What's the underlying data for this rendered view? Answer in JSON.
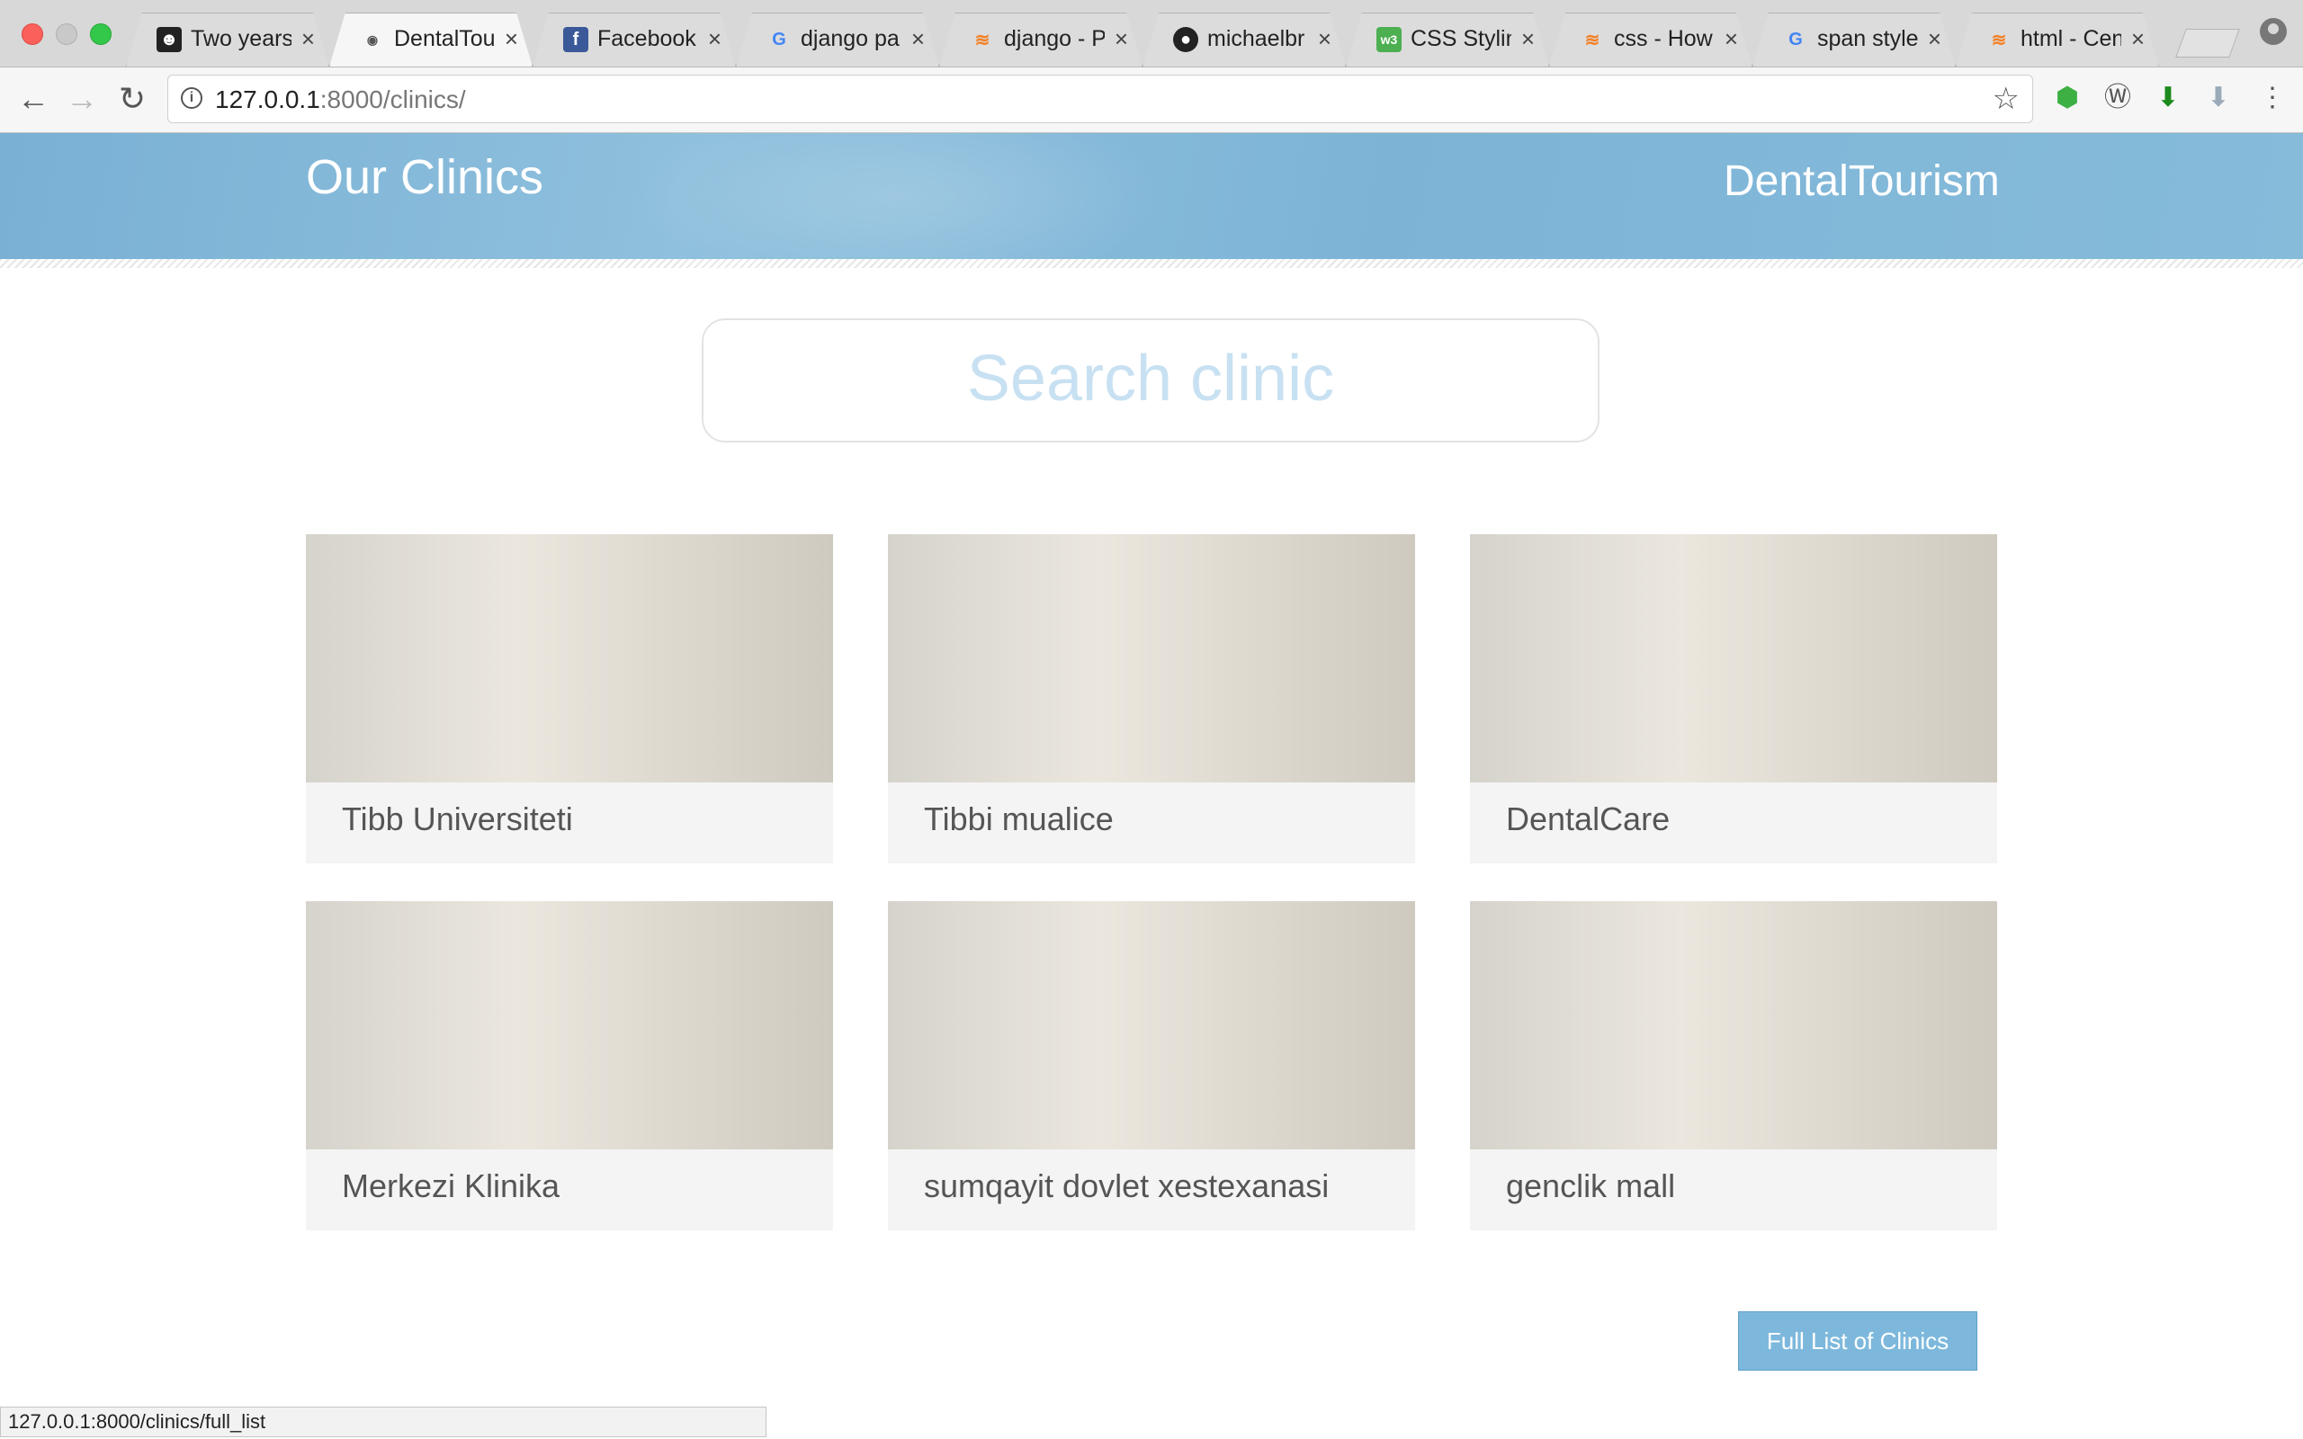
{
  "browser": {
    "tabs": [
      {
        "title": "Two years",
        "icon": "ghost-favicon-icon",
        "active": false
      },
      {
        "title": "DentalTou",
        "icon": "page-favicon-icon",
        "active": true
      },
      {
        "title": "Facebook",
        "icon": "facebook-favicon-icon",
        "active": false
      },
      {
        "title": "django pa",
        "icon": "google-favicon-icon",
        "active": false
      },
      {
        "title": "django - P",
        "icon": "stackoverflow-favicon-icon",
        "active": false
      },
      {
        "title": "michaelbr",
        "icon": "github-favicon-icon",
        "active": false
      },
      {
        "title": "CSS Stylin",
        "icon": "w3-favicon-icon",
        "active": false
      },
      {
        "title": "css - How",
        "icon": "stackoverflow-favicon-icon",
        "active": false
      },
      {
        "title": "span style",
        "icon": "google-favicon-icon",
        "active": false
      },
      {
        "title": "html - Cen",
        "icon": "stackoverflow-favicon-icon",
        "active": false
      }
    ],
    "url_host": "127.0.0.1",
    "url_rest": ":8000/clinics/",
    "status_url": "127.0.0.1:8000/clinics/full_list"
  },
  "header": {
    "title": "Our Clinics",
    "brand": "DentalTourism",
    "color": "#7fb6d8"
  },
  "search": {
    "placeholder": "Search clinic"
  },
  "clinics": [
    {
      "name": "Tibb Universiteti",
      "image": "ct-scan-photo"
    },
    {
      "name": "Tibbi mualice",
      "image": "ct-scan-photo"
    },
    {
      "name": "DentalCare",
      "image": "ct-scan-photo"
    },
    {
      "name": "Merkezi Klinika",
      "image": "ct-scan-photo"
    },
    {
      "name": "sumqayit dovlet xestexanasi",
      "image": "ct-scan-photo"
    },
    {
      "name": "genclik mall",
      "image": "ct-scan-photo"
    }
  ],
  "full_list_button": {
    "label": "Full List of Clinics",
    "color": "#7db8dc"
  }
}
